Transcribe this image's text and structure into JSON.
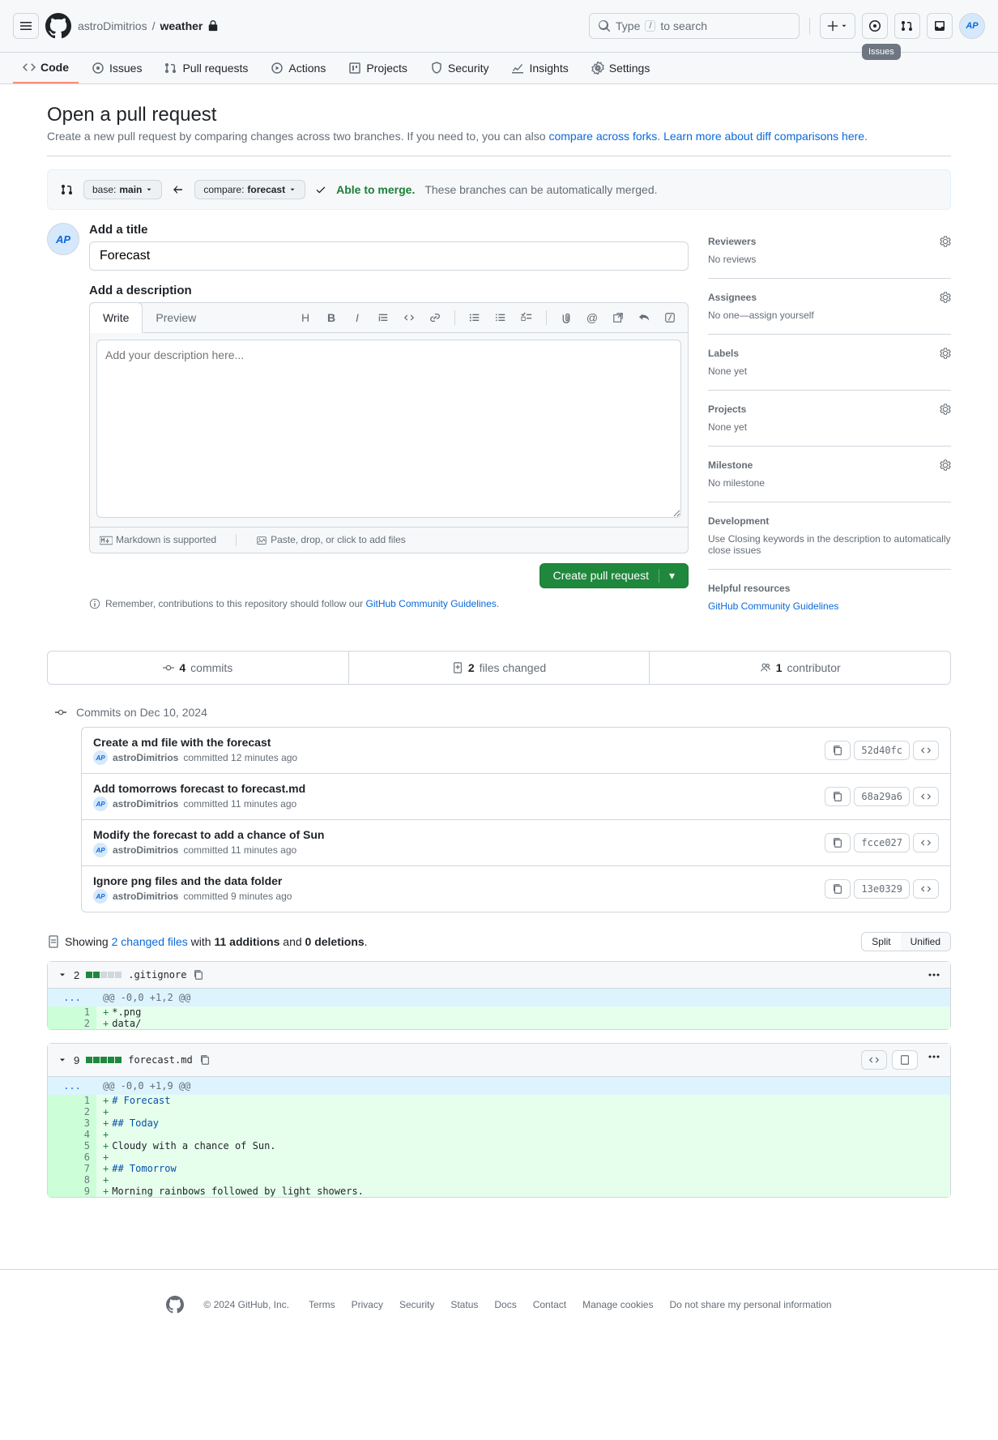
{
  "header": {
    "owner": "astroDimitrios",
    "repo": "weather",
    "searchPlaceholder": "Type / to search",
    "avatarInitials": "AP",
    "tooltip": "Issues"
  },
  "nav": {
    "code": "Code",
    "issues": "Issues",
    "pulls": "Pull requests",
    "actions": "Actions",
    "projects": "Projects",
    "security": "Security",
    "insights": "Insights",
    "settings": "Settings"
  },
  "page": {
    "title": "Open a pull request",
    "subtitle_a": "Create a new pull request by comparing changes across two branches. If you need to, you can also ",
    "subtitle_link1": "compare across forks",
    "subtitle_b": ". ",
    "subtitle_link2": "Learn more about diff comparisons here",
    "subtitle_c": "."
  },
  "compare": {
    "baseLabel": "base: ",
    "baseBranch": "main",
    "compareLabel": "compare: ",
    "compareBranch": "forecast",
    "ableMerge": "Able to merge.",
    "mergeMsg": "These branches can be automatically merged."
  },
  "form": {
    "titleLabel": "Add a title",
    "titleValue": "Forecast",
    "descLabel": "Add a description",
    "writeTab": "Write",
    "previewTab": "Preview",
    "descPlaceholder": "Add your description here...",
    "markdownNote": "Markdown is supported",
    "attachNote": "Paste, drop, or click to add files",
    "submit": "Create pull request",
    "contribNote_a": "Remember, contributions to this repository should follow our ",
    "contribNote_link": "GitHub Community Guidelines",
    "contribNote_b": "."
  },
  "sidebar": {
    "reviewers": {
      "title": "Reviewers",
      "body": "No reviews"
    },
    "assignees": {
      "title": "Assignees",
      "body_a": "No one—",
      "body_link": "assign yourself"
    },
    "labels": {
      "title": "Labels",
      "body": "None yet"
    },
    "projects": {
      "title": "Projects",
      "body": "None yet"
    },
    "milestone": {
      "title": "Milestone",
      "body": "No milestone"
    },
    "development": {
      "title": "Development",
      "body_a": "Use ",
      "body_link": "Closing keywords",
      "body_b": " in the description to automatically close issues"
    },
    "helpful": {
      "title": "Helpful resources",
      "link": "GitHub Community Guidelines"
    }
  },
  "summary": {
    "commits_n": "4",
    "commits_t": "commits",
    "files_n": "2",
    "files_t": "files changed",
    "contrib_n": "1",
    "contrib_t": "contributor"
  },
  "timeline": {
    "dateHeader": "Commits on Dec 10, 2024",
    "commits": [
      {
        "title": "Create a md file with the forecast",
        "author": "astroDimitrios",
        "meta": "committed 12 minutes ago",
        "sha": "52d40fc"
      },
      {
        "title": "Add tomorrows forecast to forecast.md",
        "author": "astroDimitrios",
        "meta": "committed 11 minutes ago",
        "sha": "68a29a6"
      },
      {
        "title": "Modify the forecast to add a chance of Sun",
        "author": "astroDimitrios",
        "meta": "committed 11 minutes ago",
        "sha": "fcce027"
      },
      {
        "title": "Ignore png files and the data folder",
        "author": "astroDimitrios",
        "meta": "committed 9 minutes ago",
        "sha": "13e0329"
      }
    ]
  },
  "diffBar": {
    "showing": "Showing ",
    "changed": "2 changed files",
    "with": " with ",
    "adds": "11 additions",
    "and": " and ",
    "dels": "0 deletions",
    "dot": ".",
    "split": "Split",
    "unified": "Unified"
  },
  "files": {
    "f1": {
      "count": "2",
      "name": ".gitignore",
      "hunk": "@@ -0,0 +1,2 @@",
      "l1": "*.png",
      "l2": "data/"
    },
    "f2": {
      "count": "9",
      "name": "forecast.md",
      "hunk": "@@ -0,0 +1,9 @@",
      "l1": "# Forecast",
      "l3": "## Today",
      "l5": "Cloudy with a chance of Sun.",
      "l7": "## Tomorrow",
      "l9": "Morning rainbows followed by light showers."
    }
  },
  "footer": {
    "copyright": "© 2024 GitHub, Inc.",
    "links": [
      "Terms",
      "Privacy",
      "Security",
      "Status",
      "Docs",
      "Contact",
      "Manage cookies",
      "Do not share my personal information"
    ]
  }
}
